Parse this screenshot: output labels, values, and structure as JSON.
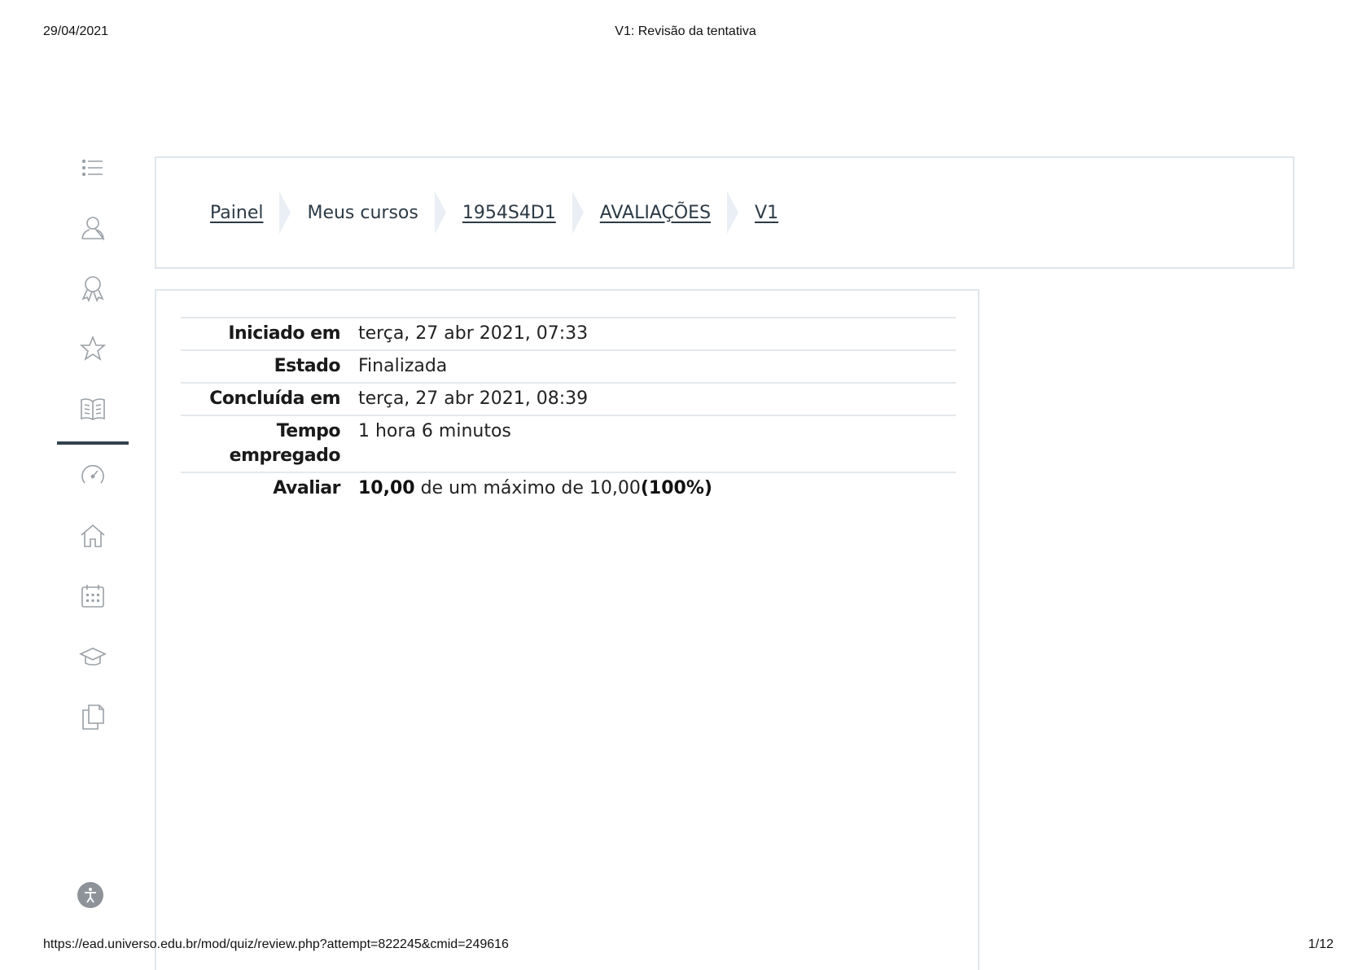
{
  "print_header": {
    "date": "29/04/2021",
    "title": "V1: Revisão da tentativa"
  },
  "print_footer": {
    "url": "https://ead.universo.edu.br/mod/quiz/review.php?attempt=822245&cmid=249616",
    "page": "1/12"
  },
  "rail": {
    "icons": [
      "list-icon",
      "user-icon",
      "badge-icon",
      "star-icon",
      "book-icon",
      "gauge-icon",
      "home-icon",
      "calendar-icon",
      "graduation-cap-icon",
      "files-icon"
    ],
    "accessibility_icon": "accessibility-icon"
  },
  "breadcrumb": [
    {
      "label": "Painel",
      "link": true
    },
    {
      "label": "Meus cursos",
      "link": false
    },
    {
      "label": "1954S4D1",
      "link": true
    },
    {
      "label": "AVALIAÇÕES",
      "link": true
    },
    {
      "label": "V1",
      "link": true
    }
  ],
  "summary": {
    "started_label": "Iniciado em",
    "started_value": "terça, 27 abr 2021, 07:33",
    "state_label": "Estado",
    "state_value": "Finalizada",
    "completed_label": "Concluída em",
    "completed_value": "terça, 27 abr 2021, 08:39",
    "time_label": "Tempo empregado",
    "time_value": "1 hora 6 minutos",
    "grade_label": "Avaliar",
    "grade_score": "10,00",
    "grade_middle": " de um máximo de 10,00",
    "grade_percent": "(100%)"
  }
}
